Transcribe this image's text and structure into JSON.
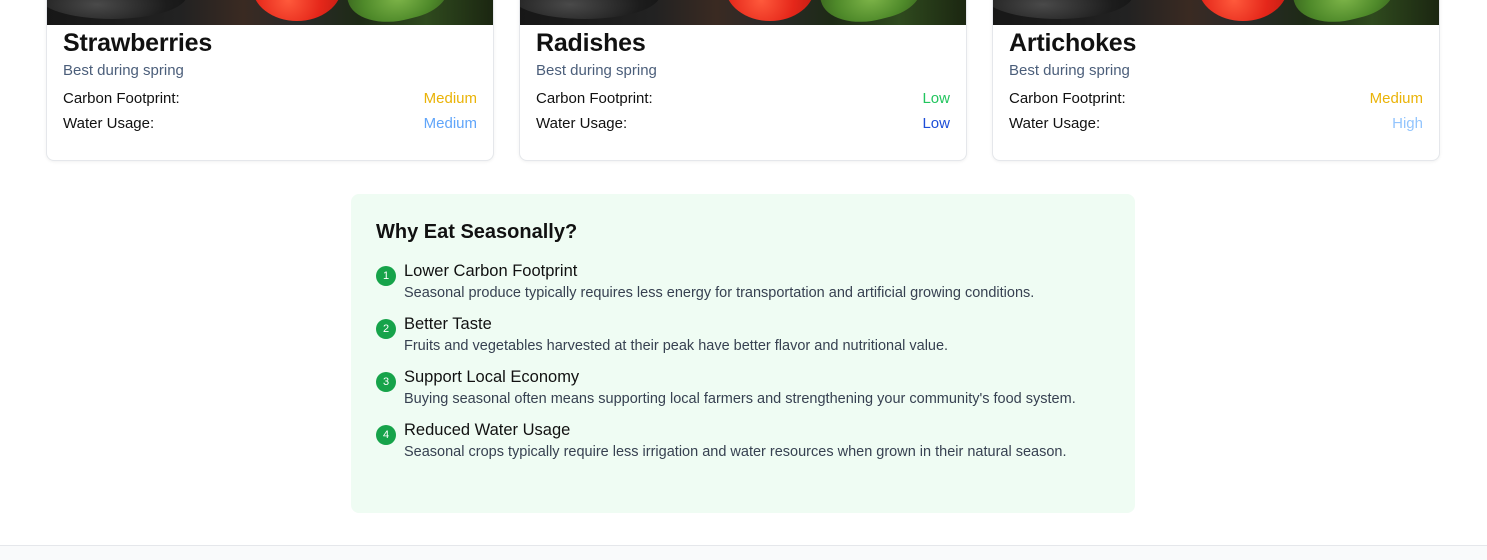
{
  "produce_cards": [
    {
      "name": "Strawberries",
      "season": "Best during spring",
      "carbon_label": "Carbon Footprint:",
      "carbon_value": "Medium",
      "carbon_color": "#eab308",
      "water_label": "Water Usage:",
      "water_value": "Medium",
      "water_color": "#60a5fa"
    },
    {
      "name": "Radishes",
      "season": "Best during spring",
      "carbon_label": "Carbon Footprint:",
      "carbon_value": "Low",
      "carbon_color": "#22c55e",
      "water_label": "Water Usage:",
      "water_value": "Low",
      "water_color": "#1d4ed8"
    },
    {
      "name": "Artichokes",
      "season": "Best during spring",
      "carbon_label": "Carbon Footprint:",
      "carbon_value": "Medium",
      "carbon_color": "#eab308",
      "water_label": "Water Usage:",
      "water_value": "High",
      "water_color": "#93c5fd"
    }
  ],
  "why_section": {
    "title": "Why Eat Seasonally?",
    "reasons": [
      {
        "number": "1",
        "title": "Lower Carbon Footprint",
        "description": "Seasonal produce typically requires less energy for transportation and artificial growing conditions."
      },
      {
        "number": "2",
        "title": "Better Taste",
        "description": "Fruits and vegetables harvested at their peak have better flavor and nutritional value."
      },
      {
        "number": "3",
        "title": "Support Local Economy",
        "description": "Buying seasonal often means supporting local farmers and strengthening your community's food system."
      },
      {
        "number": "4",
        "title": "Reduced Water Usage",
        "description": "Seasonal crops typically require less irrigation and water resources when grown in their natural season."
      }
    ],
    "accent_color": "#16a34a",
    "background_color": "#effcf3"
  }
}
